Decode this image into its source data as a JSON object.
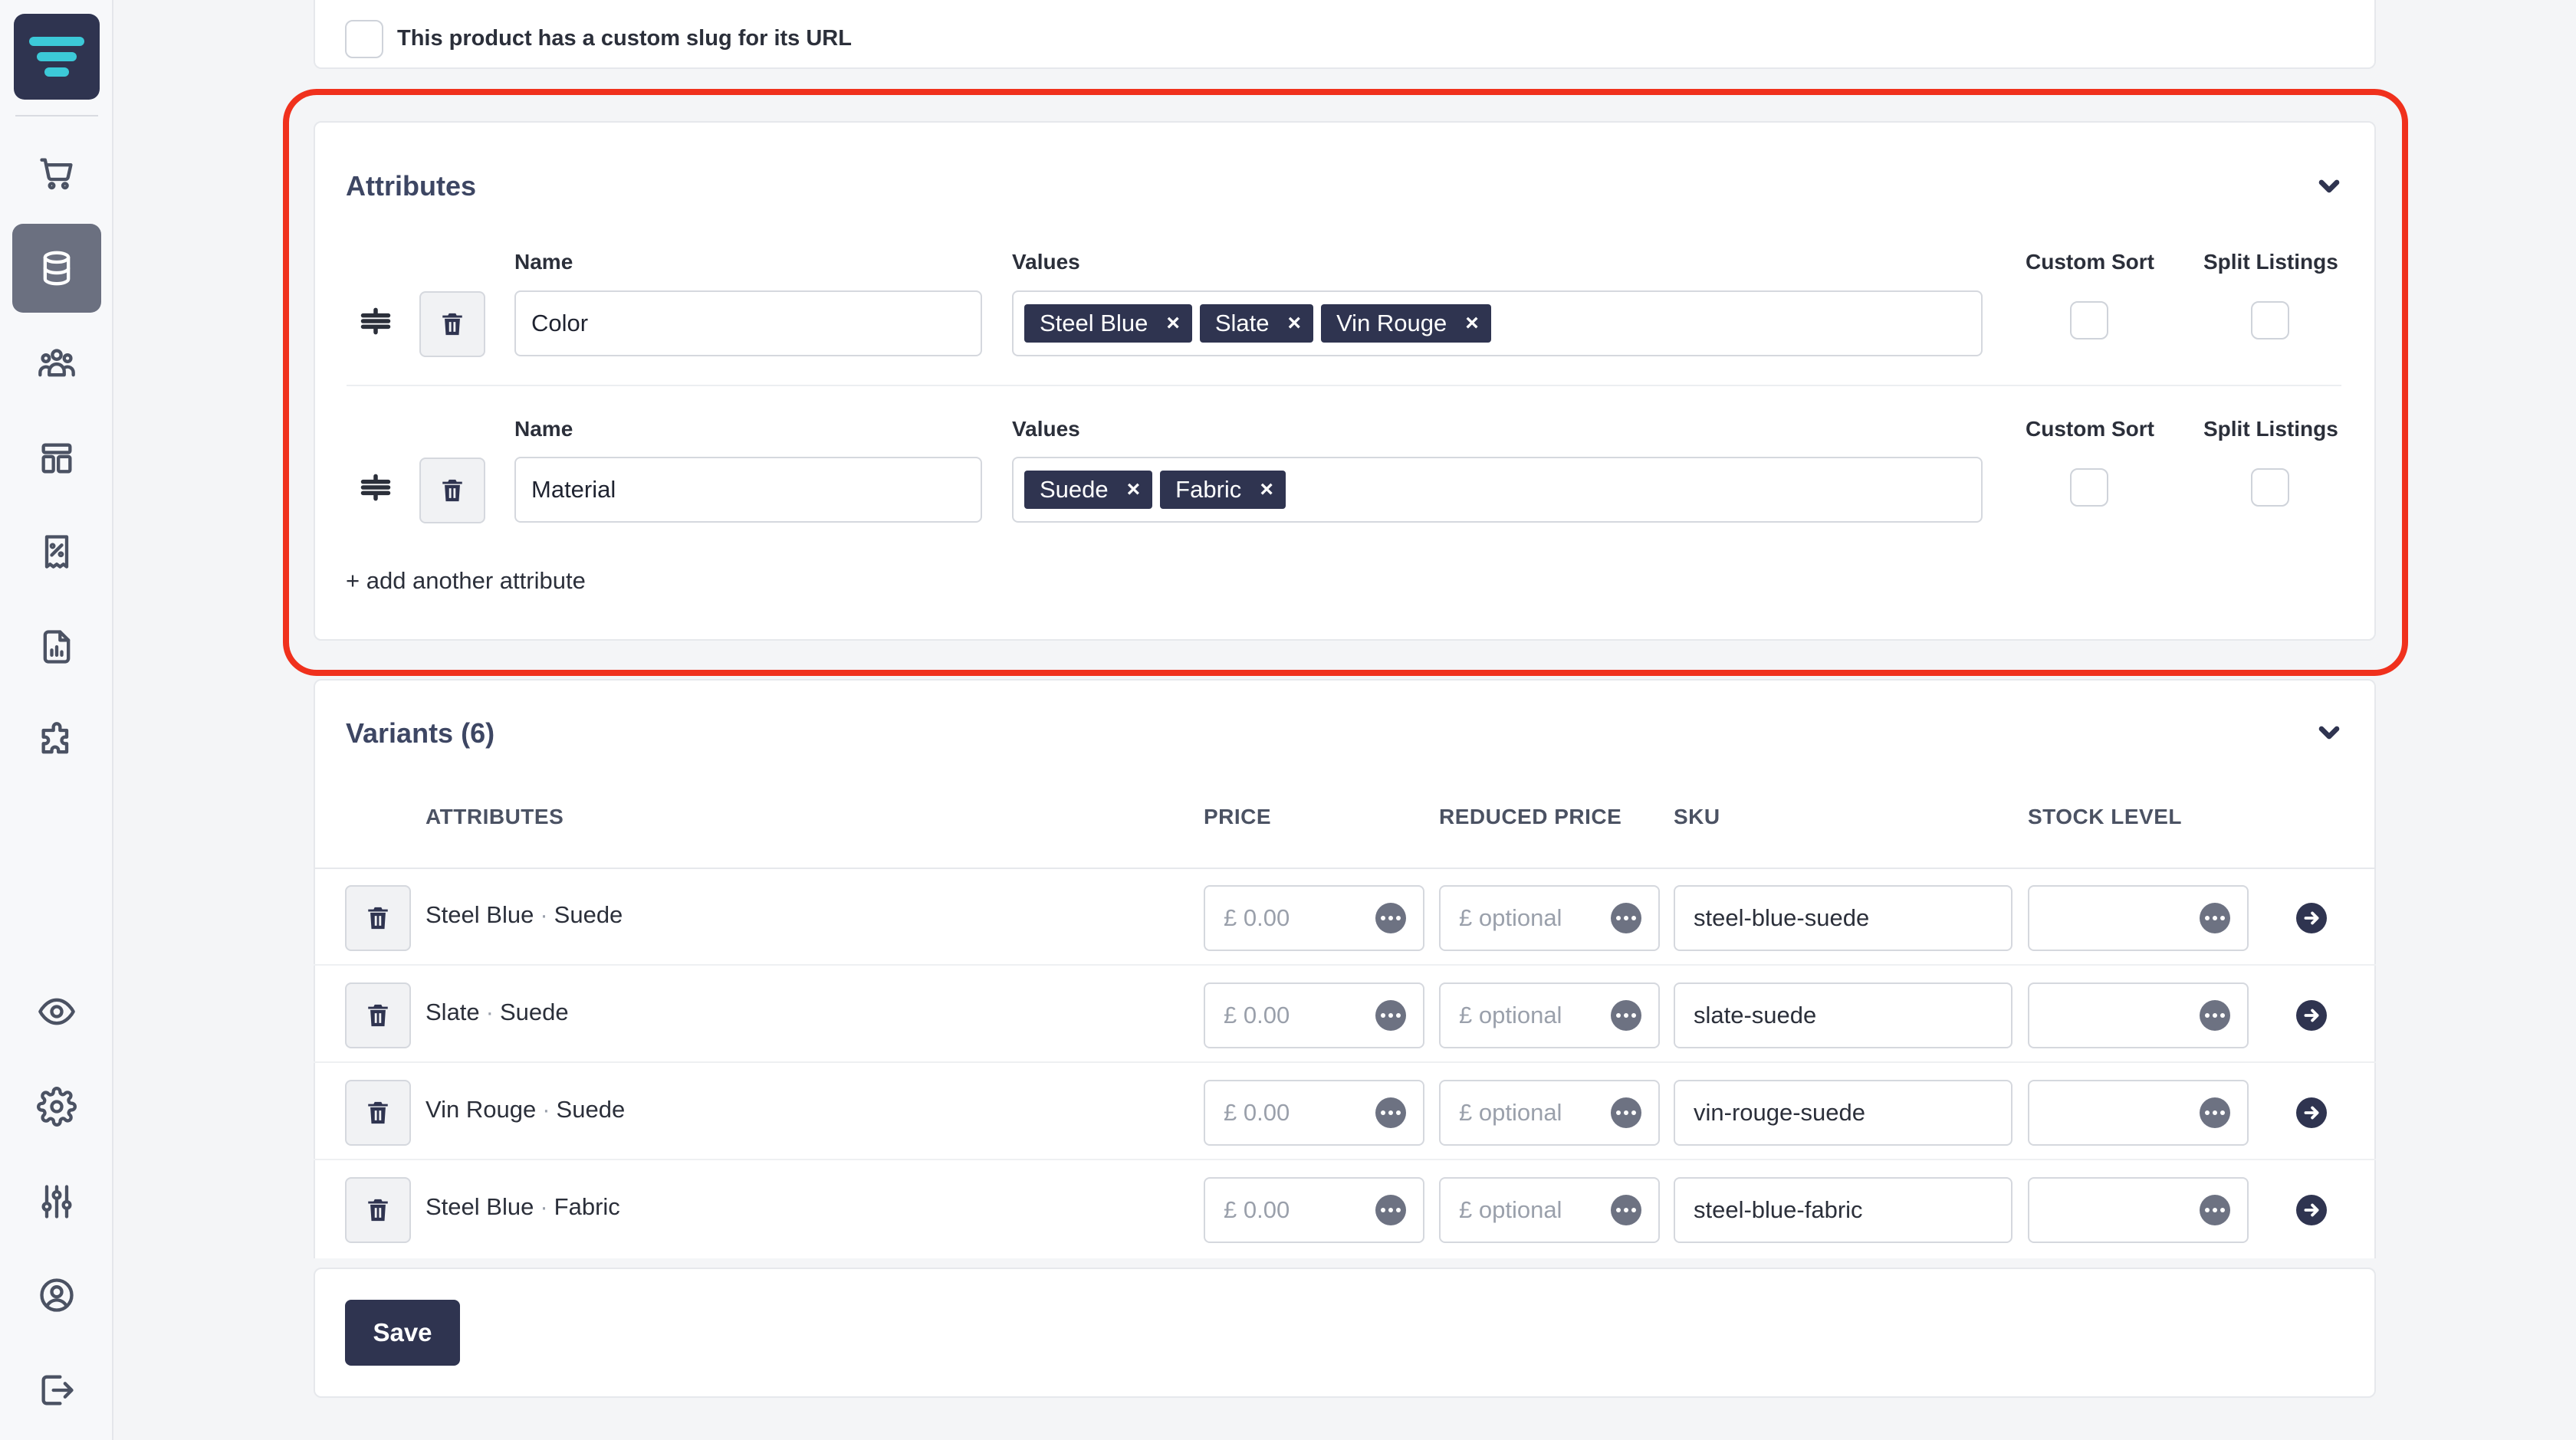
{
  "sidebar": {
    "items": [
      {
        "icon": "shopping-cart-icon",
        "active": false
      },
      {
        "icon": "database-icon",
        "active": true
      },
      {
        "icon": "users-icon",
        "active": false
      },
      {
        "icon": "layout-icon",
        "active": false
      },
      {
        "icon": "discount-receipt-icon",
        "active": false
      },
      {
        "icon": "report-file-icon",
        "active": false
      },
      {
        "icon": "puzzle-icon",
        "active": false
      },
      {
        "icon": "eye-icon",
        "active": false
      },
      {
        "icon": "gear-icon",
        "active": false
      },
      {
        "icon": "sliders-icon",
        "active": false
      },
      {
        "icon": "user-circle-icon",
        "active": false
      },
      {
        "icon": "logout-icon",
        "active": false
      }
    ]
  },
  "slug": {
    "label": "This product has a custom slug for its URL",
    "checked": false
  },
  "attributes": {
    "title": "Attributes",
    "name_label": "Name",
    "values_label": "Values",
    "custom_sort_label": "Custom Sort",
    "split_listings_label": "Split Listings",
    "rows": [
      {
        "name": "Color",
        "values": [
          "Steel Blue",
          "Slate",
          "Vin Rouge"
        ],
        "custom_sort": false,
        "split_listings": false
      },
      {
        "name": "Material",
        "values": [
          "Suede",
          "Fabric"
        ],
        "custom_sort": false,
        "split_listings": false
      }
    ],
    "remove_symbol": "×",
    "add_link": "+ add another attribute"
  },
  "variants": {
    "title": "Variants (6)",
    "columns": [
      "ATTRIBUTES",
      "PRICE",
      "REDUCED PRICE",
      "SKU",
      "STOCK LEVEL"
    ],
    "separator": "·",
    "rows": [
      {
        "color": "Steel Blue",
        "material": "Suede",
        "price": "£ 0.00",
        "reduced": "£ optional",
        "sku": "steel-blue-suede",
        "stock": ""
      },
      {
        "color": "Slate",
        "material": "Suede",
        "price": "£ 0.00",
        "reduced": "£ optional",
        "sku": "slate-suede",
        "stock": ""
      },
      {
        "color": "Vin Rouge",
        "material": "Suede",
        "price": "£ 0.00",
        "reduced": "£ optional",
        "sku": "vin-rouge-suede",
        "stock": ""
      },
      {
        "color": "Steel Blue",
        "material": "Fabric",
        "price": "£ 0.00",
        "reduced": "£ optional",
        "sku": "steel-blue-fabric",
        "stock": ""
      }
    ]
  },
  "save_label": "Save",
  "colors": {
    "brand": "#2f3450",
    "accent": "#3cc9d8",
    "highlight": "#f0311d"
  }
}
